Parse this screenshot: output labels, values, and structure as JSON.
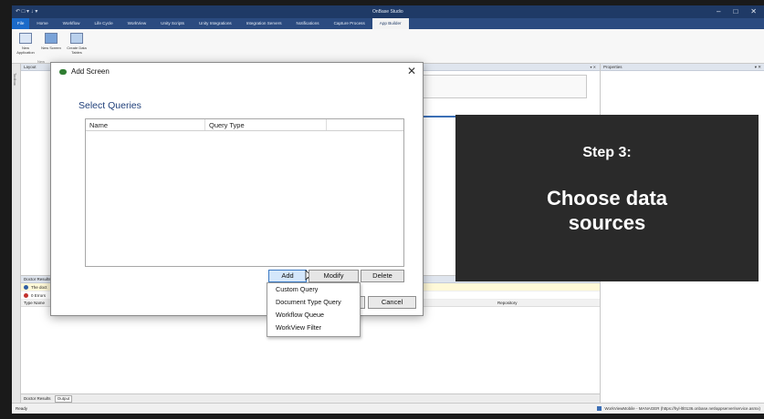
{
  "window": {
    "title": "OnBase Studio",
    "qat": "↶  □ ▾ ↓ ▾",
    "controls": [
      "–",
      "□",
      "✕"
    ]
  },
  "ribbon": {
    "tabs": [
      "File",
      "Home",
      "Workflow",
      "Life Cycle",
      "WorkView",
      "Unity Scripts",
      "Unity Integrations",
      "Integration Servers",
      "Notifications",
      "Capture Process",
      "App Builder"
    ],
    "active_tab": "App Builder",
    "buttons": [
      {
        "label": "New Application"
      },
      {
        "label": "New Screen"
      },
      {
        "label": "Create Data Tables"
      }
    ],
    "group_label": "New"
  },
  "panels": {
    "left_strip": "Toolbox",
    "layout": "Layout",
    "properties": "Properties",
    "pin": "▾ ✕"
  },
  "doctor": {
    "header": "Doctor Results",
    "rows": [
      {
        "type": "info",
        "text": "The doct"
      },
      {
        "type": "error",
        "text": "0 Errors"
      }
    ],
    "columns": {
      "type": "Type",
      "name": "Name",
      "repository": "Repository"
    },
    "bottom_tabs": [
      "Doctor Results",
      "Output"
    ]
  },
  "status": {
    "left": "Ready",
    "right": "WorkViewMobile - MANAGER (https://hyl-ltl0136.onbase.net/appserver/service.asmx)"
  },
  "dialog": {
    "title": "Add Screen",
    "close": "✕",
    "section_title": "Select Queries",
    "columns": [
      "Name",
      "Query Type",
      ""
    ],
    "buttons": {
      "add": "Add",
      "modify": "Modify",
      "delete": "Delete",
      "cancel": "Cancel"
    }
  },
  "dropdown": {
    "items": [
      "Custom Query",
      "Document Type Query",
      "Workflow Queue",
      "WorkView Filter"
    ]
  },
  "overlay": {
    "step": "Step 3:",
    "line1": "Choose data",
    "line2": "sources"
  },
  "colors": {
    "titlebar": "#1f3a66",
    "tabbar": "#2b4b80",
    "section_title": "#1f3f7a",
    "overlay": "#2a2a2a",
    "add_button": "#d4e7fb"
  }
}
